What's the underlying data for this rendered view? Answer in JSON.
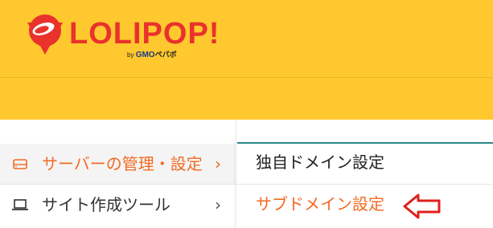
{
  "header": {
    "logo_text": "LOLIPOP!",
    "byline_by": "by",
    "byline_gmo": "GMO",
    "byline_pepabo": "ペパボ",
    "brand_color": "#fec82e",
    "logo_color": "#e9322c"
  },
  "sidebar": {
    "items": [
      {
        "label": "サーバーの管理・設定",
        "icon": "server-icon",
        "chevron": "›",
        "active": true
      },
      {
        "label": "サイト作成ツール",
        "icon": "laptop-icon",
        "chevron": "›",
        "active": false
      }
    ],
    "accent_color": "#f26a23"
  },
  "submenu": {
    "items": [
      {
        "label": "独自ドメイン設定"
      },
      {
        "label": "サブドメイン設定",
        "highlighted": true
      }
    ]
  },
  "annotation": {
    "icon": "left-arrow-icon",
    "color": "#e0201b"
  }
}
